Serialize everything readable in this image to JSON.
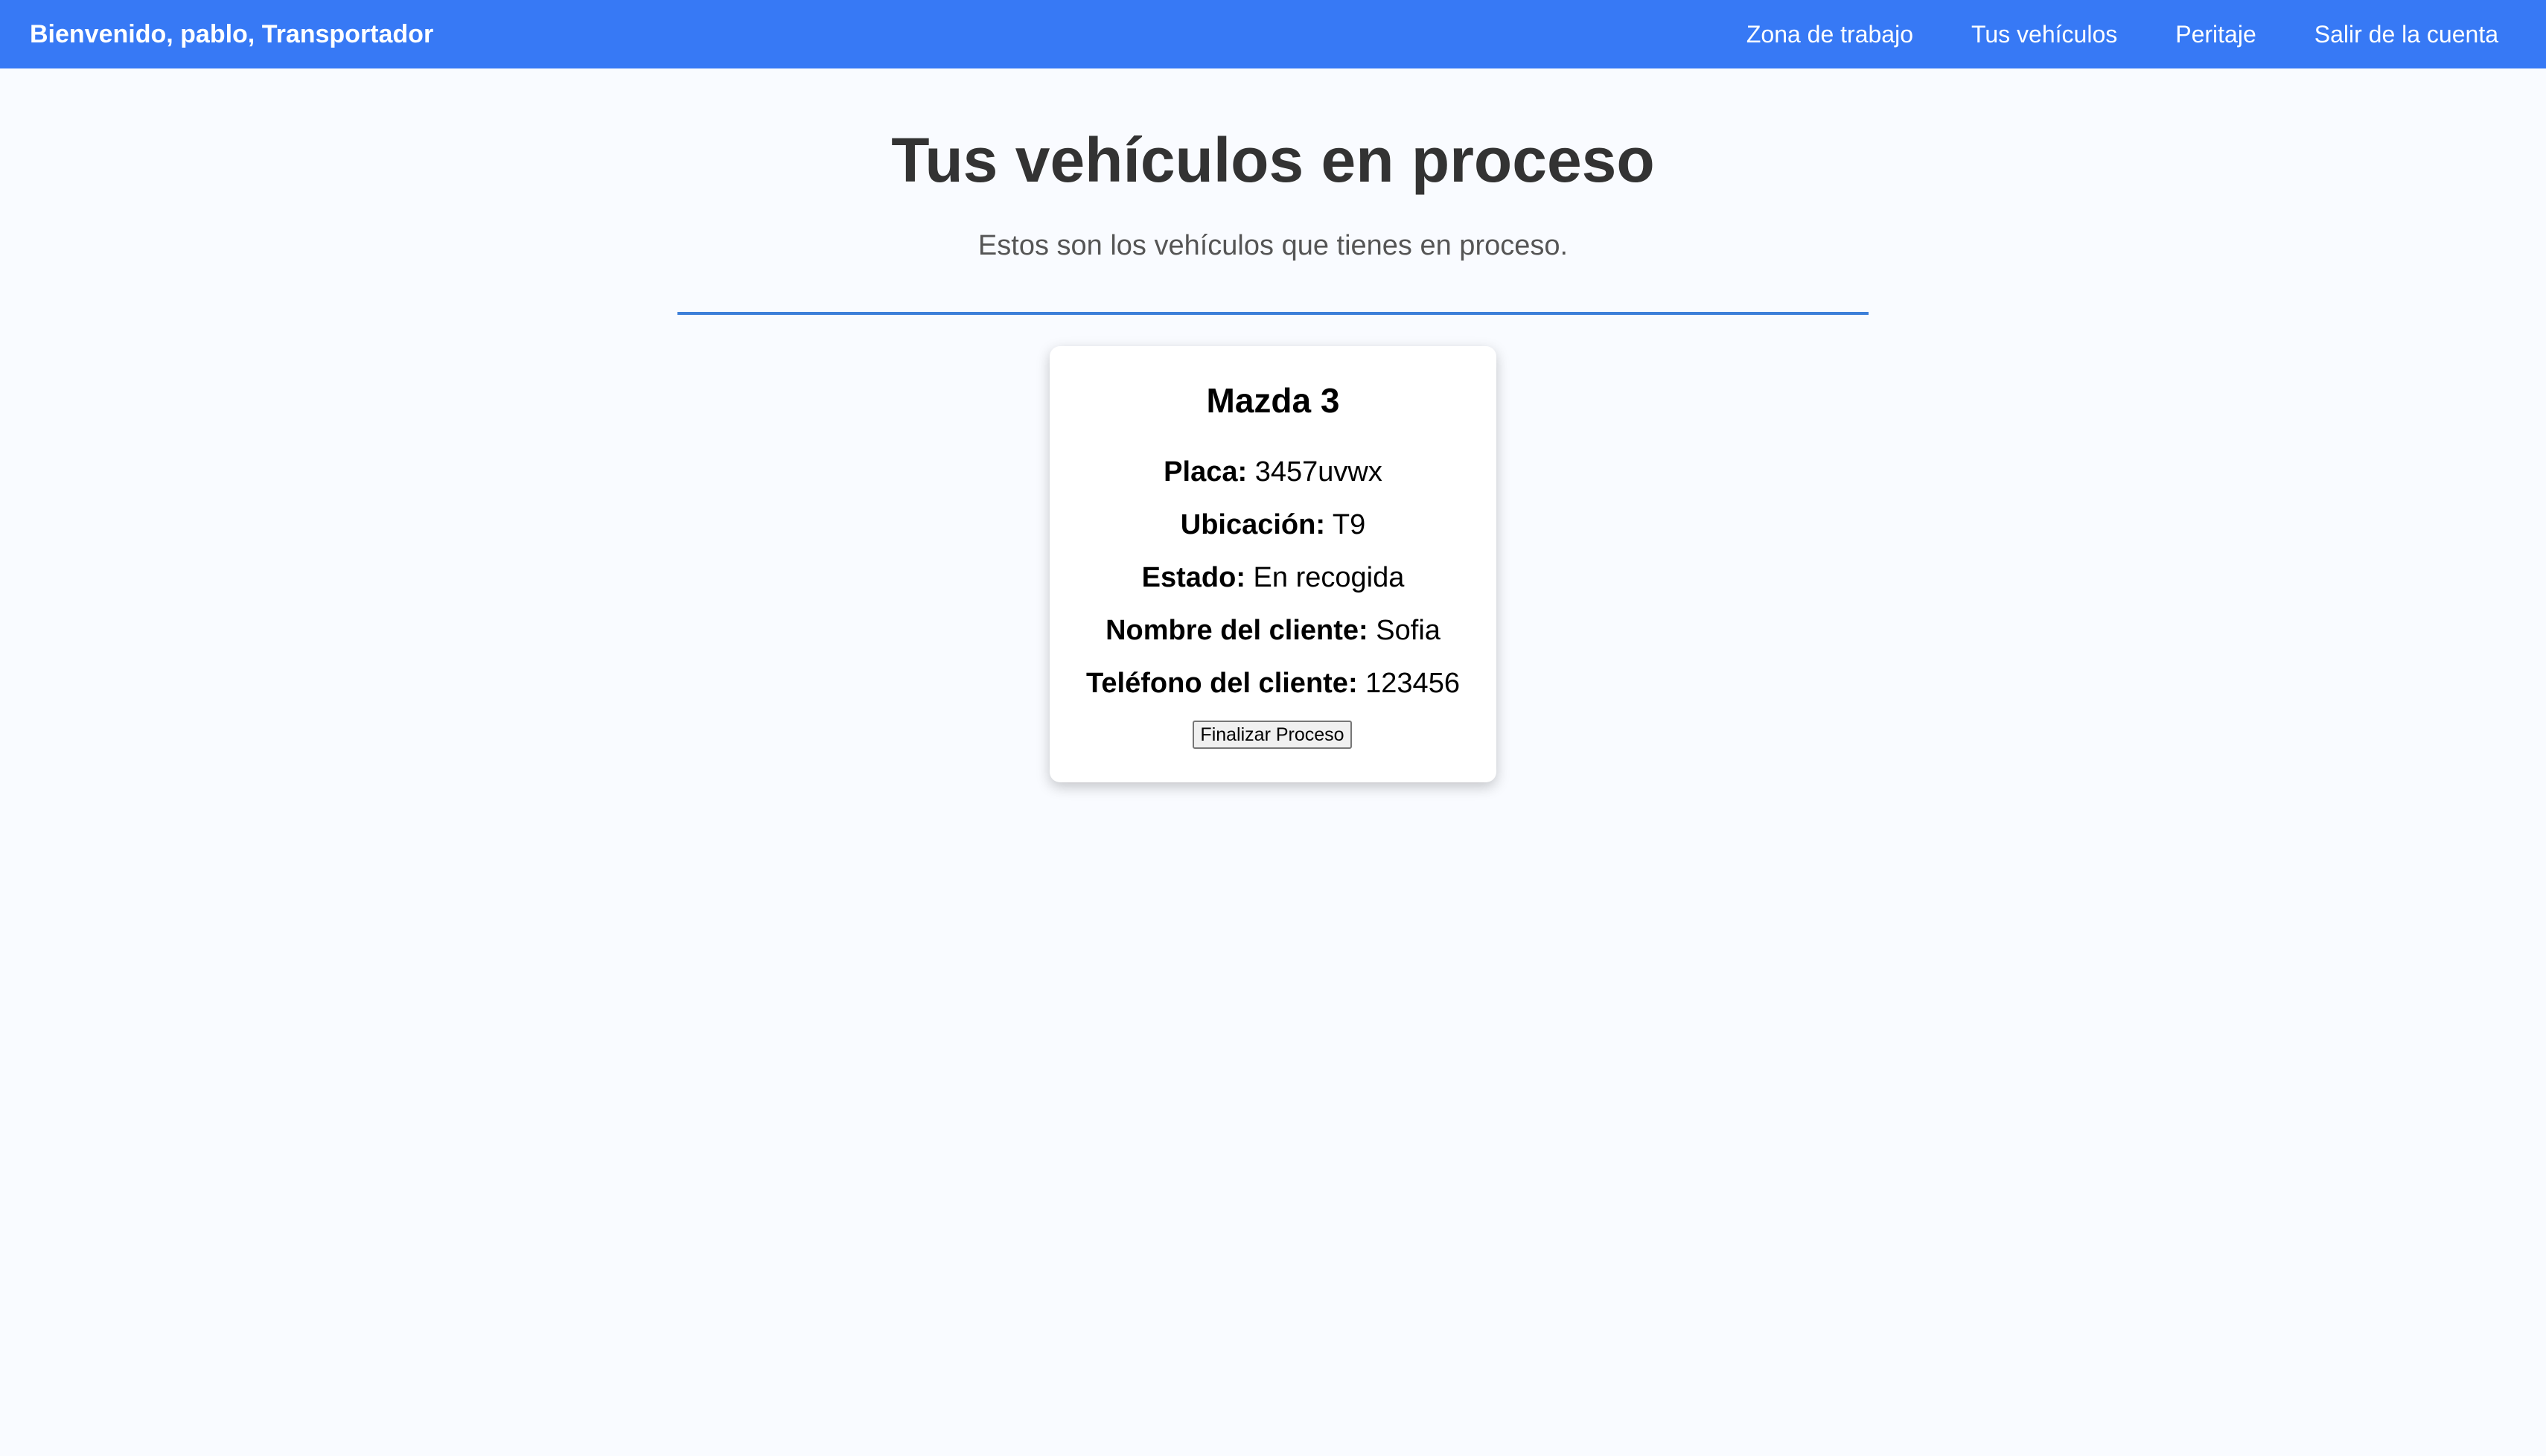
{
  "navbar": {
    "brand": "Bienvenido, pablo, Transportador",
    "links": [
      {
        "label": "Zona de trabajo"
      },
      {
        "label": "Tus vehículos"
      },
      {
        "label": "Peritaje"
      },
      {
        "label": "Salir de la cuenta"
      }
    ],
    "background_color": "#3779f5"
  },
  "main": {
    "title": "Tus vehículos en proceso",
    "subtitle": "Estos son los vehículos que tienes en proceso.",
    "divider_color": "#3d7fd9"
  },
  "vehicles": [
    {
      "name": "Mazda 3",
      "plate_label": "Placa:",
      "plate": "3457uvwx",
      "location_label": "Ubicación:",
      "location": "T9",
      "status_label": "Estado:",
      "status": "En recogida",
      "client_name_label": "Nombre del cliente:",
      "client_name": "Sofia",
      "client_phone_label": "Teléfono del cliente:",
      "client_phone": "123456",
      "action_label": "Finalizar Proceso"
    }
  ]
}
